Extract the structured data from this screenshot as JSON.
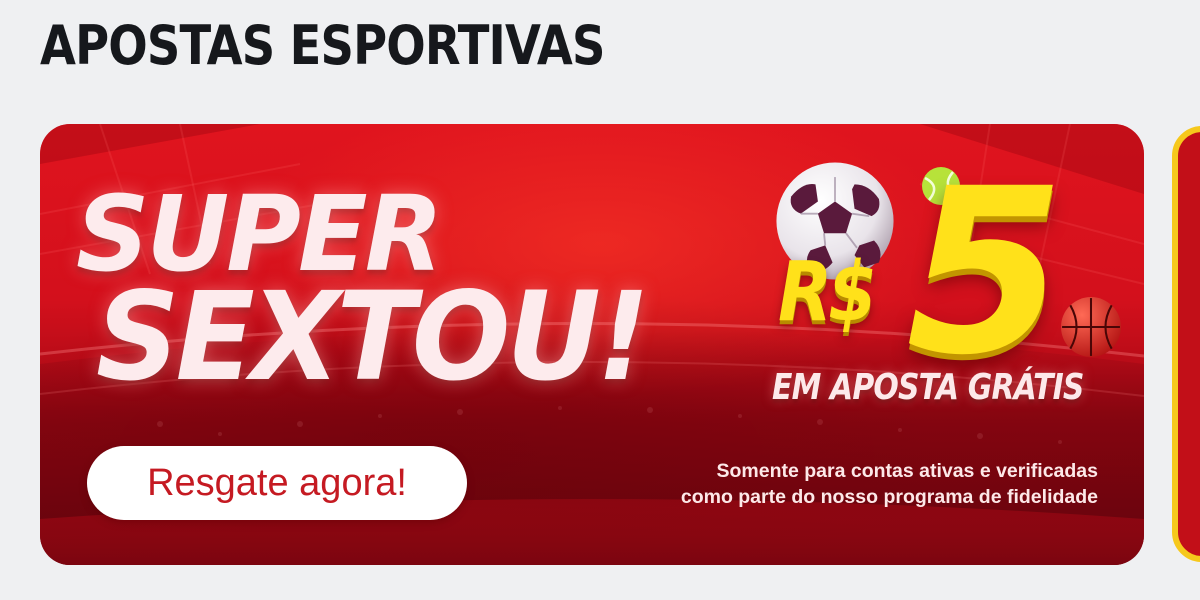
{
  "section": {
    "title": "APOSTAS ESPORTIVAS"
  },
  "banner": {
    "headline_line1": "SUPER",
    "headline_line2": "SEXTOU!",
    "cta_label": "Resgate agora!",
    "currency": "R$",
    "amount": "5",
    "offer_label": "EM APOSTA GRÁTIS",
    "disclaimer_line1": "Somente para contas ativas e verificadas",
    "disclaimer_line2": "como parte do nosso programa de fidelidade",
    "icons": [
      "soccer-ball-icon",
      "tennis-ball-icon",
      "basketball-icon"
    ],
    "colors": {
      "background_red": "#d3101c",
      "accent_yellow": "#ffe11a",
      "cta_text": "#c51a22",
      "next_card_border": "#f6c81c"
    }
  },
  "page": {
    "background": "#eff0f2"
  }
}
